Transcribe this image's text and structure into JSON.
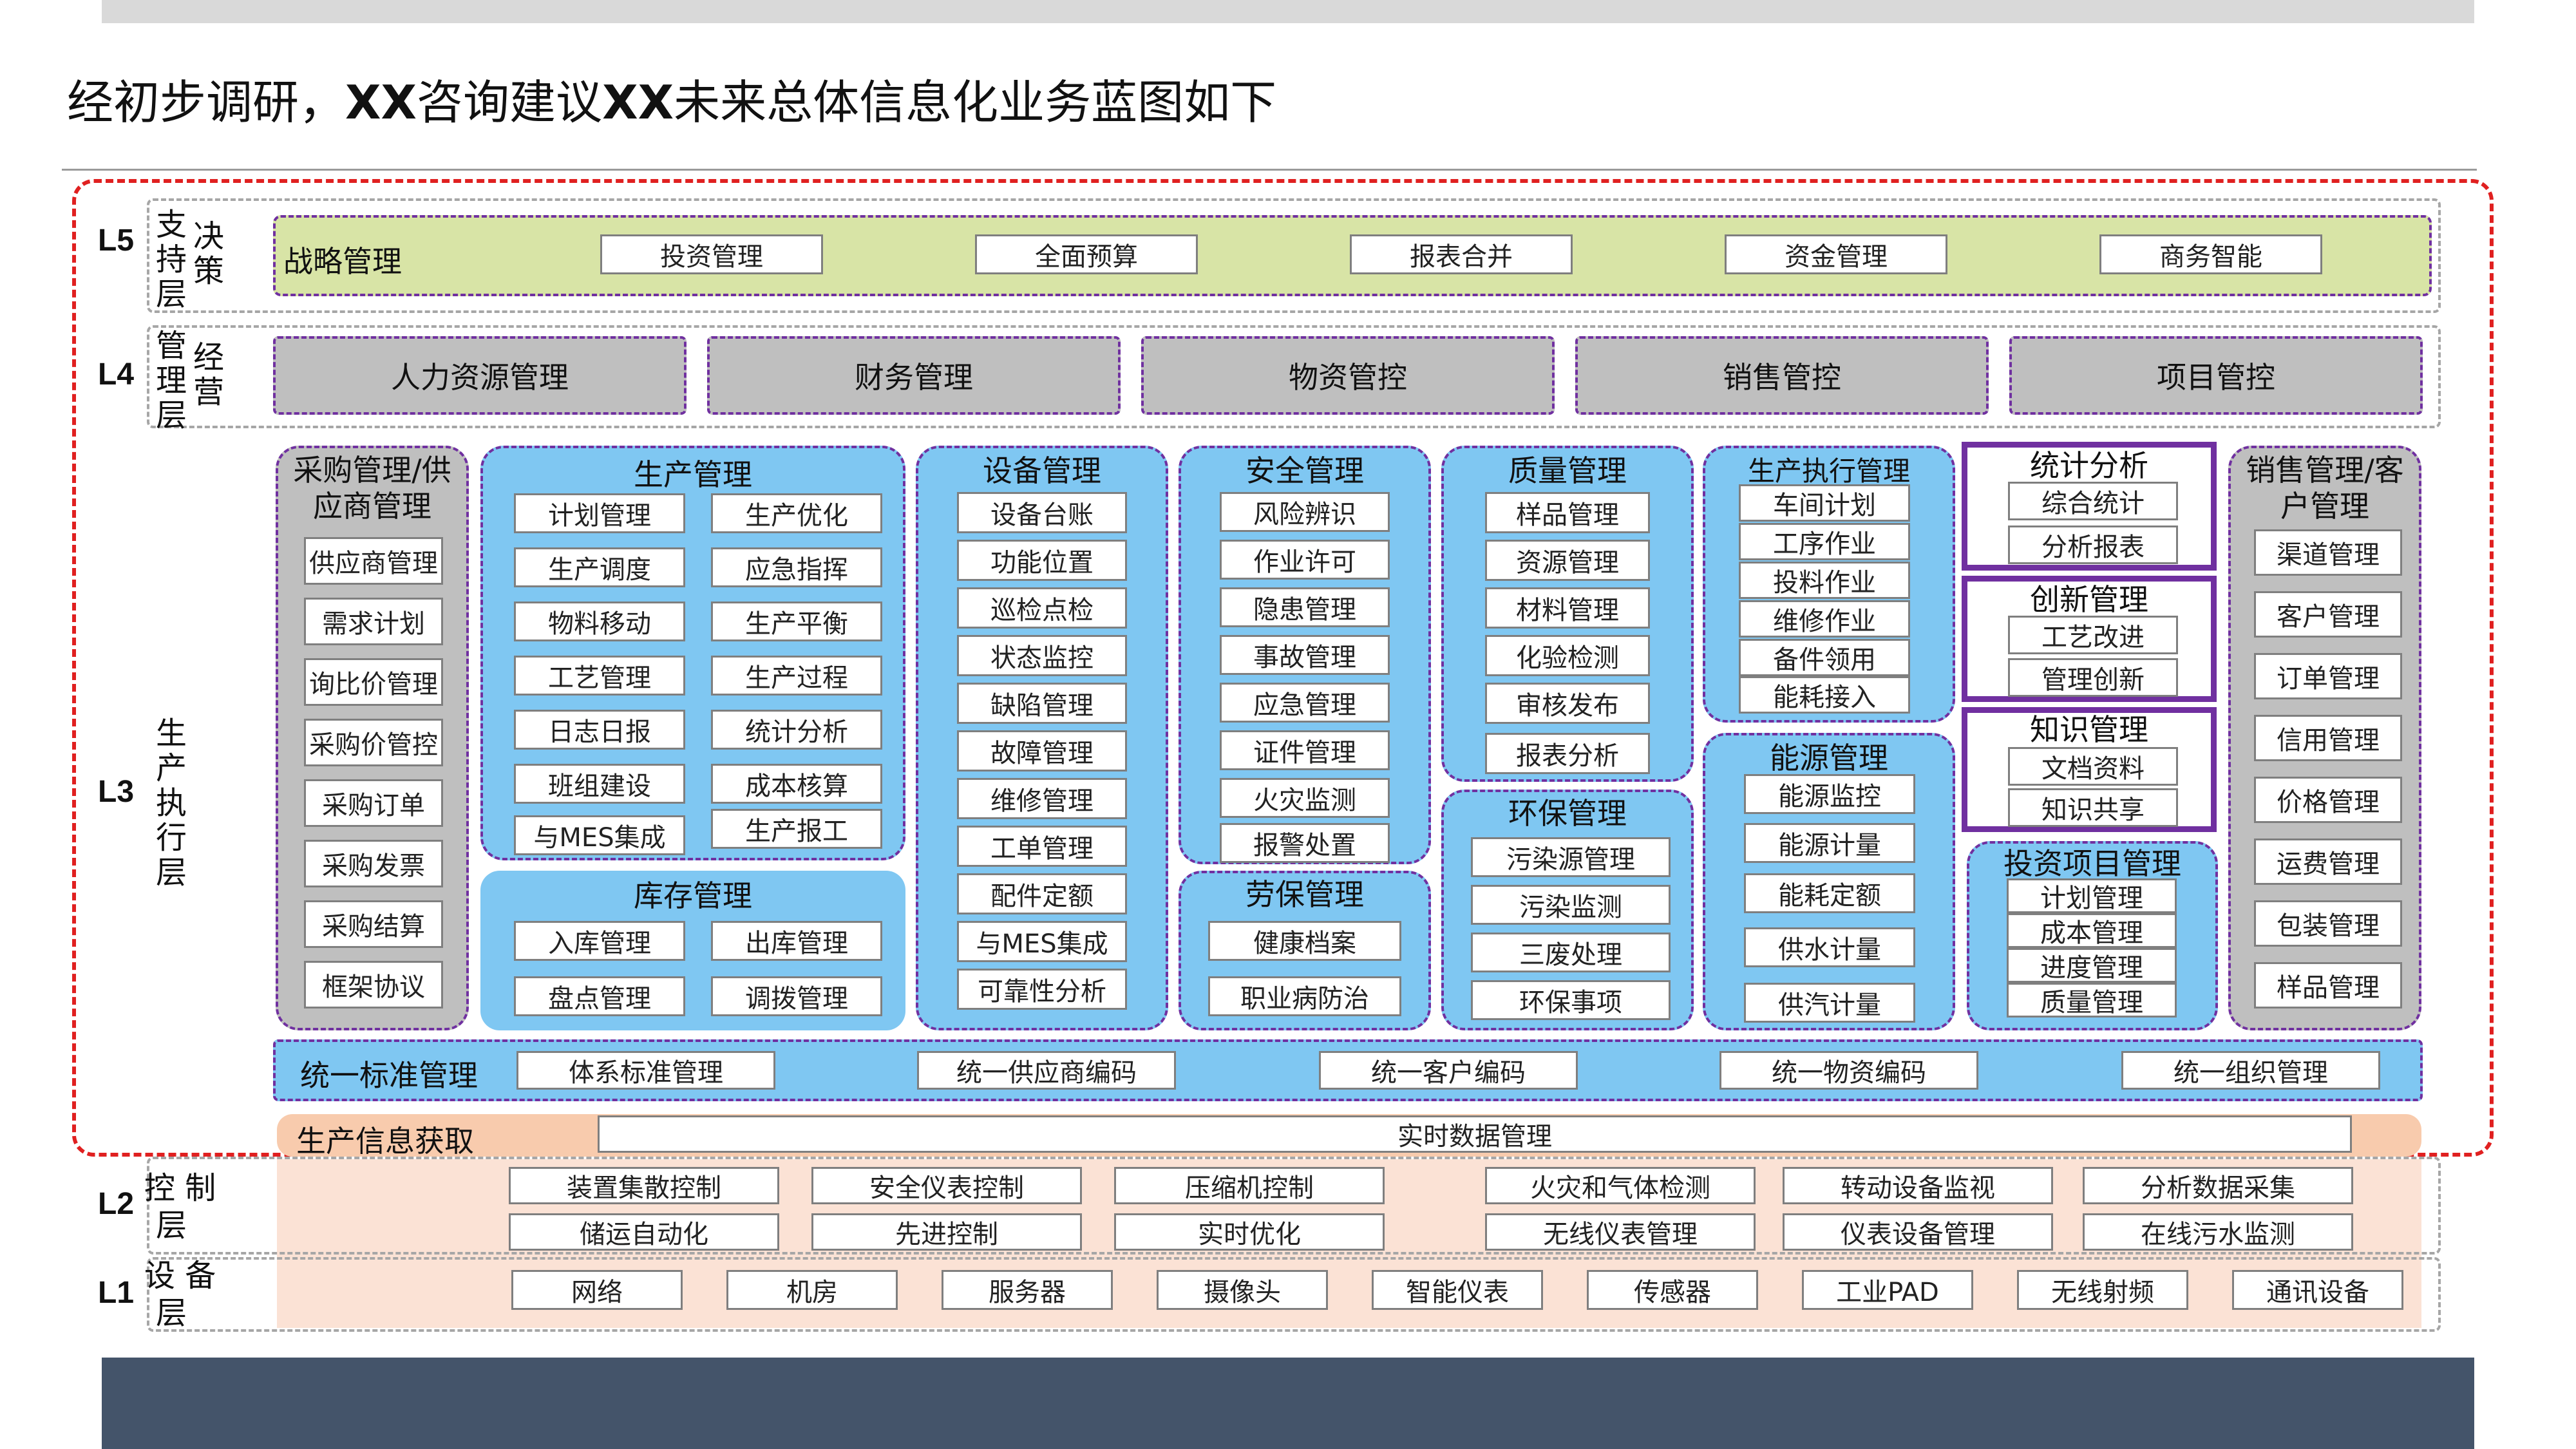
{
  "title": {
    "part1": "经初步调研，",
    "xx1": "XX",
    "part2": "咨询建议",
    "xx2": "XX",
    "part3": "未来总体信息化业务蓝图如下"
  },
  "layers": {
    "L5": {
      "code": "L5",
      "label1": "支持层",
      "label2": "决策"
    },
    "L4": {
      "code": "L4",
      "label1": "管理层",
      "label2": "经营"
    },
    "L3": {
      "code": "L3",
      "label": "生产执行层"
    },
    "L2": {
      "code": "L2",
      "label1": "控 制",
      "label2": "层"
    },
    "L1": {
      "code": "L1",
      "label1": "设 备",
      "label2": "层"
    }
  },
  "l5": {
    "title": "战略管理",
    "items": [
      "投资管理",
      "全面预算",
      "报表合并",
      "资金管理",
      "商务智能"
    ]
  },
  "l4": {
    "items": [
      "人力资源管理",
      "财务管理",
      "物资管控",
      "销售管控",
      "项目管控"
    ]
  },
  "l3": {
    "purchase": {
      "title": "采购管理/供应商管理",
      "items": [
        "供应商管理",
        "需求计划",
        "询比价管理",
        "采购价管控",
        "采购订单",
        "采购发票",
        "采购结算",
        "框架协议"
      ]
    },
    "production": {
      "title": "生产管理",
      "left": [
        "计划管理",
        "生产调度",
        "物料移动",
        "工艺管理",
        "日志日报",
        "班组建设",
        "与MES集成"
      ],
      "right": [
        "生产优化",
        "应急指挥",
        "生产平衡",
        "生产过程",
        "统计分析",
        "成本核算",
        "生产报工"
      ]
    },
    "inventory": {
      "title": "库存管理",
      "items": [
        "入库管理",
        "出库管理",
        "盘点管理",
        "调拨管理"
      ]
    },
    "equipment": {
      "title": "设备管理",
      "items": [
        "设备台账",
        "功能位置",
        "巡检点检",
        "状态监控",
        "缺陷管理",
        "故障管理",
        "维修管理",
        "工单管理",
        "配件定额",
        "与MES集成",
        "可靠性分析"
      ]
    },
    "safety": {
      "title": "安全管理",
      "items": [
        "风险辨识",
        "作业许可",
        "隐患管理",
        "事故管理",
        "应急管理",
        "证件管理",
        "火灾监测",
        "报警处置"
      ]
    },
    "labor": {
      "title": "劳保管理",
      "items": [
        "健康档案",
        "职业病防治"
      ]
    },
    "quality": {
      "title": "质量管理",
      "items": [
        "样品管理",
        "资源管理",
        "材料管理",
        "化验检测",
        "审核发布",
        "报表分析"
      ]
    },
    "env": {
      "title": "环保管理",
      "items": [
        "污染源管理",
        "污染监测",
        "三废处理",
        "环保事项"
      ]
    },
    "exec": {
      "title": "生产执行管理",
      "items": [
        "车间计划",
        "工序作业",
        "投料作业",
        "维修作业",
        "备件领用",
        "能耗接入"
      ]
    },
    "energy": {
      "title": "能源管理",
      "items": [
        "能源监控",
        "能源计量",
        "能耗定额",
        "供水计量",
        "供汽计量"
      ]
    },
    "stats": {
      "title": "统计分析",
      "items": [
        "综合统计",
        "分析报表"
      ]
    },
    "innovation": {
      "title": "创新管理",
      "items": [
        "工艺改进",
        "管理创新"
      ]
    },
    "knowledge": {
      "title": "知识管理",
      "items": [
        "文档资料",
        "知识共享"
      ]
    },
    "invest": {
      "title": "投资项目管理",
      "items": [
        "计划管理",
        "成本管理",
        "进度管理",
        "质量管理"
      ]
    },
    "sales": {
      "title": "销售管理/客户管理",
      "items": [
        "渠道管理",
        "客户管理",
        "订单管理",
        "信用管理",
        "价格管理",
        "运费管理",
        "包装管理",
        "样品管理"
      ]
    }
  },
  "standard": {
    "title": "统一标准管理",
    "items": [
      "体系标准管理",
      "统一供应商编码",
      "统一客户编码",
      "统一物资编码",
      "统一组织管理"
    ]
  },
  "info": {
    "title": "生产信息获取",
    "item": "实时数据管理"
  },
  "l2": {
    "row1": [
      "装置集散控制",
      "安全仪表控制",
      "压缩机控制",
      "火灾和气体检测",
      "转动设备监视",
      "分析数据采集"
    ],
    "row2": [
      "储运自动化",
      "先进控制",
      "实时优化",
      "无线仪表管理",
      "仪表设备管理",
      "在线污水监测"
    ]
  },
  "l1": {
    "items": [
      "网络",
      "机房",
      "服务器",
      "摄像头",
      "智能仪表",
      "传感器",
      "工业PAD",
      "无线射频",
      "通讯设备"
    ]
  }
}
